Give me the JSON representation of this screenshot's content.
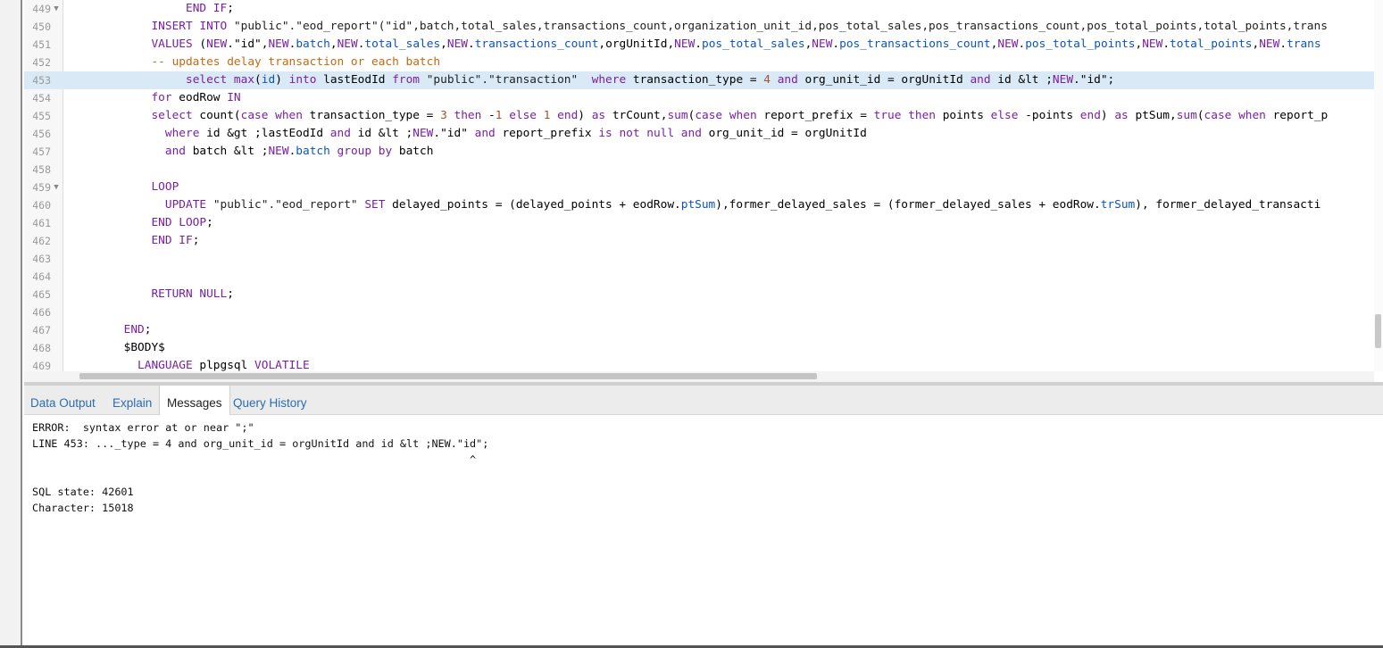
{
  "editor": {
    "lines": [
      {
        "n": "449",
        "fold": "▼",
        "indent": "                 ",
        "tokens": [
          [
            "kw",
            "END IF"
          ],
          [
            "plain",
            ";"
          ]
        ]
      },
      {
        "n": "450",
        "fold": "",
        "indent": "            ",
        "tokens": [
          [
            "kw",
            "INSERT INTO "
          ],
          [
            "str",
            "\"public\".\"eod_report\"(\"id\",batch,total_sales,transactions_count,organization_unit_id,pos_total_sales,pos_transactions_count,pos_total_points,total_points,trans"
          ]
        ]
      },
      {
        "n": "451",
        "fold": "",
        "indent": "            ",
        "tokens": [
          [
            "kw",
            "VALUES "
          ],
          [
            "plain",
            "("
          ],
          [
            "kw",
            "NEW"
          ],
          [
            "plain",
            ".\"id\","
          ],
          [
            "kw",
            "NEW"
          ],
          [
            "plain",
            "."
          ],
          [
            "var",
            "batch"
          ],
          [
            "plain",
            ","
          ],
          [
            "kw",
            "NEW"
          ],
          [
            "plain",
            "."
          ],
          [
            "var",
            "total_sales"
          ],
          [
            "plain",
            ","
          ],
          [
            "kw",
            "NEW"
          ],
          [
            "plain",
            "."
          ],
          [
            "var",
            "transactions_count"
          ],
          [
            "plain",
            ",orgUnitId,"
          ],
          [
            "kw",
            "NEW"
          ],
          [
            "plain",
            "."
          ],
          [
            "var",
            "pos_total_sales"
          ],
          [
            "plain",
            ","
          ],
          [
            "kw",
            "NEW"
          ],
          [
            "plain",
            "."
          ],
          [
            "var",
            "pos_transactions_count"
          ],
          [
            "plain",
            ","
          ],
          [
            "kw",
            "NEW"
          ],
          [
            "plain",
            "."
          ],
          [
            "var",
            "pos_total_points"
          ],
          [
            "plain",
            ","
          ],
          [
            "kw",
            "NEW"
          ],
          [
            "plain",
            "."
          ],
          [
            "var",
            "total_points"
          ],
          [
            "plain",
            ","
          ],
          [
            "kw",
            "NEW"
          ],
          [
            "plain",
            "."
          ],
          [
            "var",
            "trans"
          ]
        ]
      },
      {
        "n": "452",
        "fold": "",
        "indent": "            ",
        "tokens": [
          [
            "cm",
            "-- updates delay transaction or each batch"
          ]
        ]
      },
      {
        "n": "453",
        "fold": "",
        "indent": "                 ",
        "active": true,
        "tokens": [
          [
            "kw",
            "select "
          ],
          [
            "fn",
            "max"
          ],
          [
            "plain",
            "("
          ],
          [
            "var",
            "id"
          ],
          [
            "plain",
            ") "
          ],
          [
            "kw",
            "into "
          ],
          [
            "plain",
            "lastEodId "
          ],
          [
            "kw",
            "from "
          ],
          [
            "str",
            "\"public\".\"transaction\""
          ],
          [
            "plain",
            "  "
          ],
          [
            "kw",
            "where "
          ],
          [
            "plain",
            "transaction_type = "
          ],
          [
            "num",
            "4"
          ],
          [
            "plain",
            " "
          ],
          [
            "kw",
            "and "
          ],
          [
            "plain",
            "org_unit_id = orgUnitId "
          ],
          [
            "kw",
            "and "
          ],
          [
            "plain",
            "id &lt ;"
          ],
          [
            "kw",
            "NEW"
          ],
          [
            "plain",
            ".\"id\";"
          ]
        ]
      },
      {
        "n": "454",
        "fold": "",
        "indent": "            ",
        "tokens": [
          [
            "kw",
            "for "
          ],
          [
            "plain",
            "eodRow "
          ],
          [
            "kw",
            "IN"
          ]
        ]
      },
      {
        "n": "455",
        "fold": "",
        "indent": "            ",
        "tokens": [
          [
            "kw",
            "select "
          ],
          [
            "plain",
            "count("
          ],
          [
            "kw",
            "case when "
          ],
          [
            "plain",
            "transaction_type = "
          ],
          [
            "num",
            "3"
          ],
          [
            "plain",
            " "
          ],
          [
            "kw",
            "then "
          ],
          [
            "plain",
            "-"
          ],
          [
            "num",
            "1"
          ],
          [
            "plain",
            " "
          ],
          [
            "kw",
            "else "
          ],
          [
            "num",
            "1"
          ],
          [
            "plain",
            " "
          ],
          [
            "kw",
            "end"
          ],
          [
            "plain",
            ") "
          ],
          [
            "kw",
            "as "
          ],
          [
            "plain",
            "trCount,"
          ],
          [
            "fn",
            "sum"
          ],
          [
            "plain",
            "("
          ],
          [
            "kw",
            "case when "
          ],
          [
            "plain",
            "report_prefix = "
          ],
          [
            "kw",
            "true then "
          ],
          [
            "plain",
            "points "
          ],
          [
            "kw",
            "else "
          ],
          [
            "plain",
            "-points "
          ],
          [
            "kw",
            "end"
          ],
          [
            "plain",
            ") "
          ],
          [
            "kw",
            "as "
          ],
          [
            "plain",
            "ptSum,"
          ],
          [
            "fn",
            "sum"
          ],
          [
            "plain",
            "("
          ],
          [
            "kw",
            "case when "
          ],
          [
            "plain",
            "report_p"
          ]
        ]
      },
      {
        "n": "456",
        "fold": "",
        "indent": "              ",
        "tokens": [
          [
            "kw",
            "where "
          ],
          [
            "plain",
            "id &gt ;lastEodId "
          ],
          [
            "kw",
            "and "
          ],
          [
            "plain",
            "id &lt ;"
          ],
          [
            "kw",
            "NEW"
          ],
          [
            "plain",
            ".\"id\" "
          ],
          [
            "kw",
            "and "
          ],
          [
            "plain",
            "report_prefix "
          ],
          [
            "kw",
            "is not null and "
          ],
          [
            "plain",
            "org_unit_id = orgUnitId"
          ]
        ]
      },
      {
        "n": "457",
        "fold": "",
        "indent": "              ",
        "tokens": [
          [
            "kw",
            "and "
          ],
          [
            "plain",
            "batch &lt ;"
          ],
          [
            "kw",
            "NEW"
          ],
          [
            "plain",
            "."
          ],
          [
            "var",
            "batch"
          ],
          [
            "plain",
            " "
          ],
          [
            "kw",
            "group by "
          ],
          [
            "plain",
            "batch"
          ]
        ]
      },
      {
        "n": "458",
        "fold": "",
        "indent": "",
        "tokens": []
      },
      {
        "n": "459",
        "fold": "▼",
        "indent": "            ",
        "tokens": [
          [
            "kw",
            "LOOP"
          ]
        ]
      },
      {
        "n": "460",
        "fold": "",
        "indent": "              ",
        "tokens": [
          [
            "kw",
            "UPDATE "
          ],
          [
            "str",
            "\"public\".\"eod_report\" "
          ],
          [
            "kw",
            "SET "
          ],
          [
            "plain",
            "delayed_points = (delayed_points + eodRow."
          ],
          [
            "var",
            "ptSum"
          ],
          [
            "plain",
            "),former_delayed_sales = (former_delayed_sales + eodRow."
          ],
          [
            "var",
            "trSum"
          ],
          [
            "plain",
            "), former_delayed_transacti"
          ]
        ]
      },
      {
        "n": "461",
        "fold": "",
        "indent": "            ",
        "tokens": [
          [
            "kw",
            "END LOOP"
          ],
          [
            "plain",
            ";"
          ]
        ]
      },
      {
        "n": "462",
        "fold": "",
        "indent": "            ",
        "tokens": [
          [
            "kw",
            "END IF"
          ],
          [
            "plain",
            ";"
          ]
        ]
      },
      {
        "n": "463",
        "fold": "",
        "indent": "",
        "tokens": []
      },
      {
        "n": "464",
        "fold": "",
        "indent": "",
        "tokens": []
      },
      {
        "n": "465",
        "fold": "",
        "indent": "            ",
        "tokens": [
          [
            "kw",
            "RETURN NULL"
          ],
          [
            "plain",
            ";"
          ]
        ]
      },
      {
        "n": "466",
        "fold": "",
        "indent": "",
        "tokens": []
      },
      {
        "n": "467",
        "fold": "",
        "indent": "        ",
        "tokens": [
          [
            "kw",
            "END"
          ],
          [
            "plain",
            ";"
          ]
        ]
      },
      {
        "n": "468",
        "fold": "",
        "indent": "        ",
        "tokens": [
          [
            "plain",
            "$BODY$"
          ]
        ]
      },
      {
        "n": "469",
        "fold": "",
        "indent": "          ",
        "tokens": [
          [
            "kw",
            "LANGUAGE "
          ],
          [
            "plain",
            "plpgsql "
          ],
          [
            "kw",
            "VOLATILE"
          ]
        ]
      }
    ]
  },
  "panel": {
    "tabs": [
      {
        "label": "Data Output",
        "name": "tab-data-output"
      },
      {
        "label": "Explain",
        "name": "tab-explain"
      },
      {
        "label": "Messages",
        "name": "tab-messages",
        "active": true
      },
      {
        "label": "Query History",
        "name": "tab-query-history"
      }
    ],
    "messages": [
      "ERROR:  syntax error at or near \";\"",
      "LINE 453: ..._type = 4 and org_unit_id = orgUnitId and id &lt ;NEW.\"id\";",
      "                                                                     ^",
      "",
      "SQL state: 42601",
      "Character: 15018"
    ]
  },
  "colors": {
    "keyword": "#7a1fa2",
    "variable": "#0b55b9",
    "number": "#a0562c",
    "comment": "#c06a12",
    "active_line": "#d9e9f5",
    "tab_link": "#2a6db0"
  }
}
